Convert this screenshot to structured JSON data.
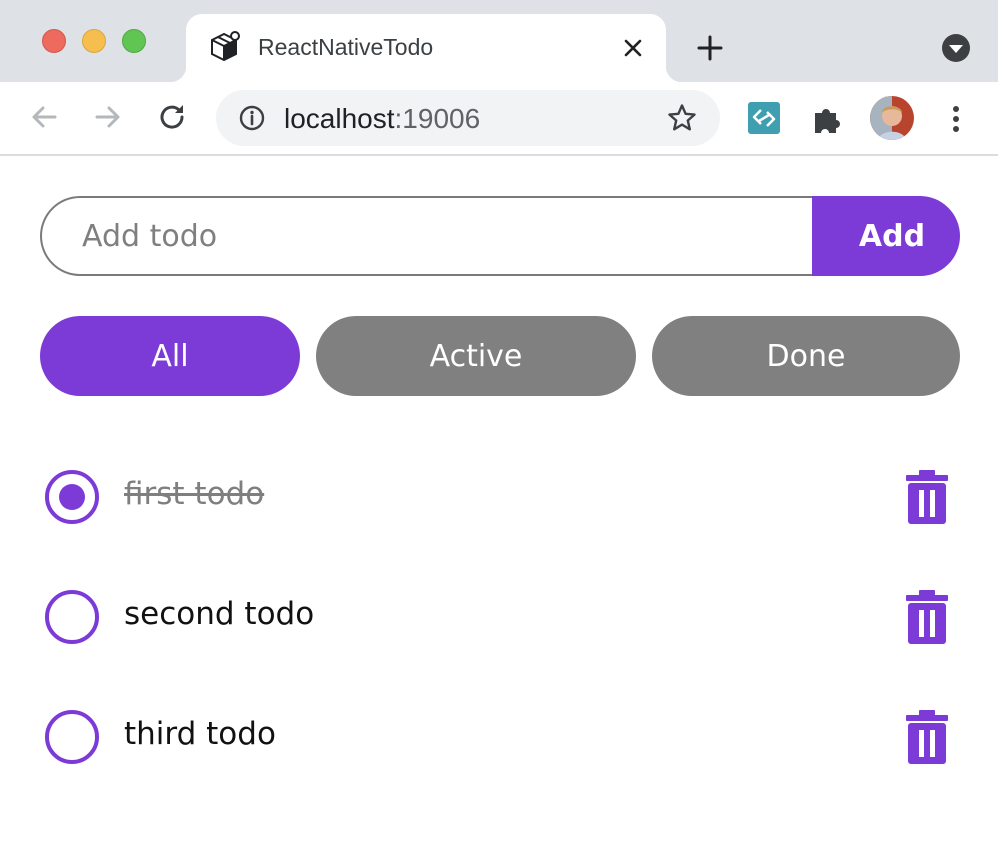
{
  "browser": {
    "tab_title": "ReactNativeTodo",
    "url_host": "localhost",
    "url_port": ":19006",
    "accent": "#7c3ad6"
  },
  "icons": {
    "favicon": "package-icon",
    "close": "close-icon",
    "new_tab": "plus-icon",
    "tab_menu": "chevron-down-circle-icon",
    "back": "back-arrow-icon",
    "forward": "forward-arrow-icon",
    "reload": "reload-icon",
    "site_info": "info-icon",
    "bookmark": "star-icon",
    "extension": "extension-icon",
    "extensions_menu": "puzzle-icon",
    "profile": "avatar",
    "menu": "kebab-menu-icon",
    "delete": "trash-icon"
  },
  "add": {
    "placeholder": "Add todo",
    "button_label": "Add"
  },
  "filters": [
    {
      "label": "All",
      "selected": true
    },
    {
      "label": "Active",
      "selected": false
    },
    {
      "label": "Done",
      "selected": false
    }
  ],
  "todos": [
    {
      "text": "first todo",
      "done": true
    },
    {
      "text": "second todo",
      "done": false
    },
    {
      "text": "third todo",
      "done": false
    }
  ]
}
